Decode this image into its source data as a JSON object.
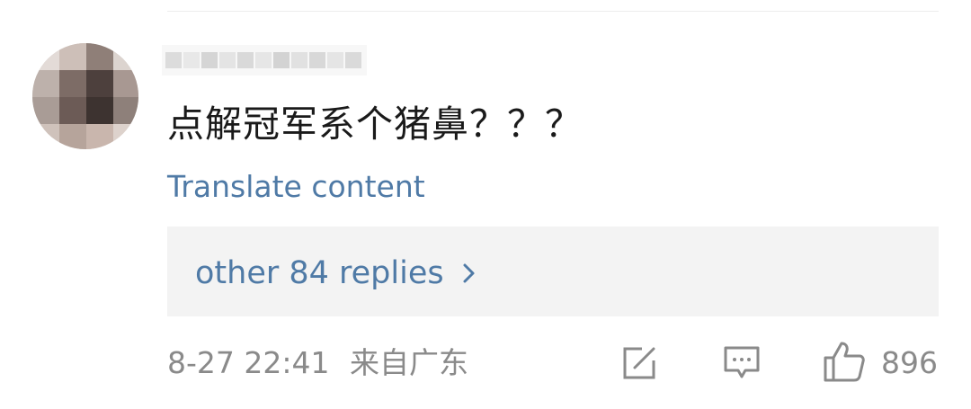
{
  "comment": {
    "text": "点解冠军系个猪鼻？？？",
    "translate_label": "Translate content",
    "replies_label": "other 84 replies",
    "timestamp": "8-27 22:41",
    "location": "来自广东",
    "like_count": "896"
  },
  "icons": {
    "avatar": "avatar-image",
    "username": "username-redacted",
    "chevron": "chevron-right-icon",
    "share": "share-icon",
    "comment": "comment-icon",
    "like": "thumbs-up-icon"
  },
  "colors": {
    "text_primary": "#1a1a1a",
    "link_blue": "#4f7aa6",
    "meta_gray": "#8a8a8a",
    "reply_box_bg": "#f3f3f3"
  }
}
